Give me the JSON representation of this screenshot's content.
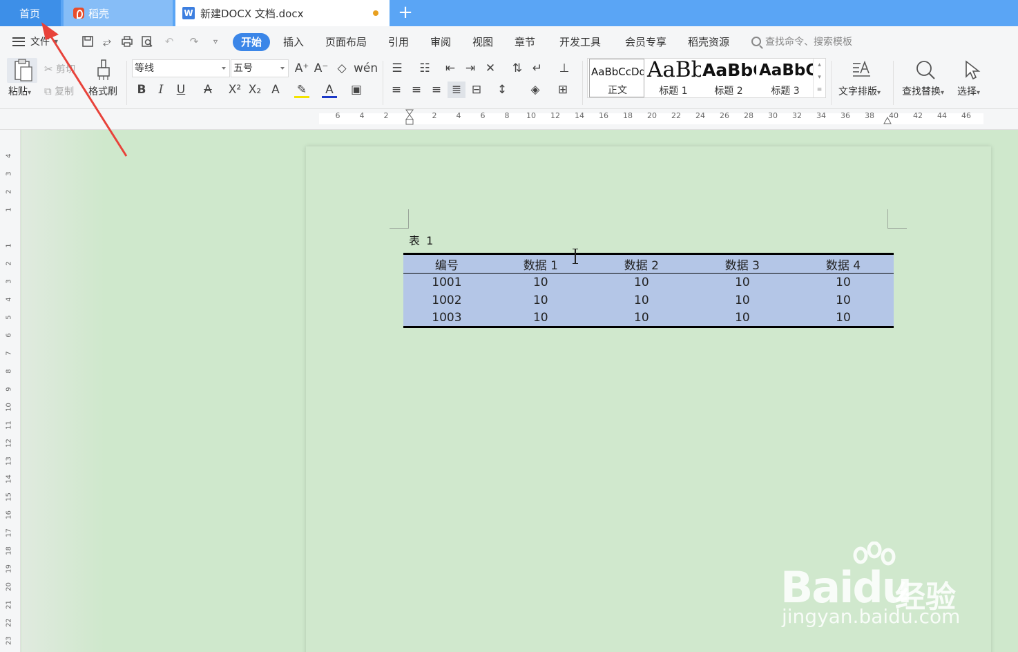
{
  "tabs": {
    "home": "首页",
    "docer": "稻壳",
    "document": "新建DOCX 文档.docx",
    "add": "+"
  },
  "menu": {
    "file": "文件",
    "tabs": [
      "开始",
      "插入",
      "页面布局",
      "引用",
      "审阅",
      "视图",
      "章节",
      "开发工具",
      "会员专享",
      "稻壳资源"
    ],
    "search_placeholder": "查找命令、搜索模板"
  },
  "ribbon": {
    "paste": "粘贴",
    "cut": "剪切",
    "copy": "复制",
    "format_painter": "格式刷",
    "font_name": "等线",
    "font_size": "五号",
    "text_layout": "文字排版",
    "find_replace": "查找替换",
    "select": "选择",
    "styles": [
      {
        "sample": "AaBbCcDd",
        "name": "正文"
      },
      {
        "sample": "AaBb",
        "name": "标题 1"
      },
      {
        "sample": "AaBbC",
        "name": "标题 2"
      },
      {
        "sample": "AaBbC",
        "name": "标题 3"
      }
    ]
  },
  "ruler": {
    "h_ticks": [
      "6",
      "4",
      "2",
      "2",
      "4",
      "6",
      "8",
      "10",
      "12",
      "14",
      "16",
      "18",
      "20",
      "22",
      "24",
      "26",
      "28",
      "30",
      "32",
      "34",
      "36",
      "38",
      "40",
      "42",
      "44",
      "46"
    ],
    "v_ticks": [
      "4",
      "3",
      "2",
      "1",
      "1",
      "2",
      "3",
      "4",
      "5",
      "6",
      "7",
      "8",
      "9",
      "10",
      "11",
      "12",
      "13",
      "14",
      "15",
      "16",
      "17",
      "18",
      "19",
      "20",
      "21",
      "22",
      "23"
    ]
  },
  "document": {
    "caption": "表 1",
    "table": {
      "headers": [
        "编号",
        "数据 1",
        "数据 2",
        "数据 3",
        "数据 4"
      ],
      "rows": [
        [
          "1001",
          "10",
          "10",
          "10",
          "10"
        ],
        [
          "1002",
          "10",
          "10",
          "10",
          "10"
        ],
        [
          "1003",
          "10",
          "10",
          "10",
          "10"
        ]
      ]
    }
  },
  "watermark": {
    "brand": "Bai",
    "brand_du": "du",
    "cn": "经验",
    "url": "jingyan.baidu.com"
  },
  "colors": {
    "tabbar": "#5aa5f5",
    "active_tab": "#3b86e8",
    "table_fill": "#b4c6e7",
    "page": "#d0e8cd",
    "arrow": "#e8423a"
  }
}
